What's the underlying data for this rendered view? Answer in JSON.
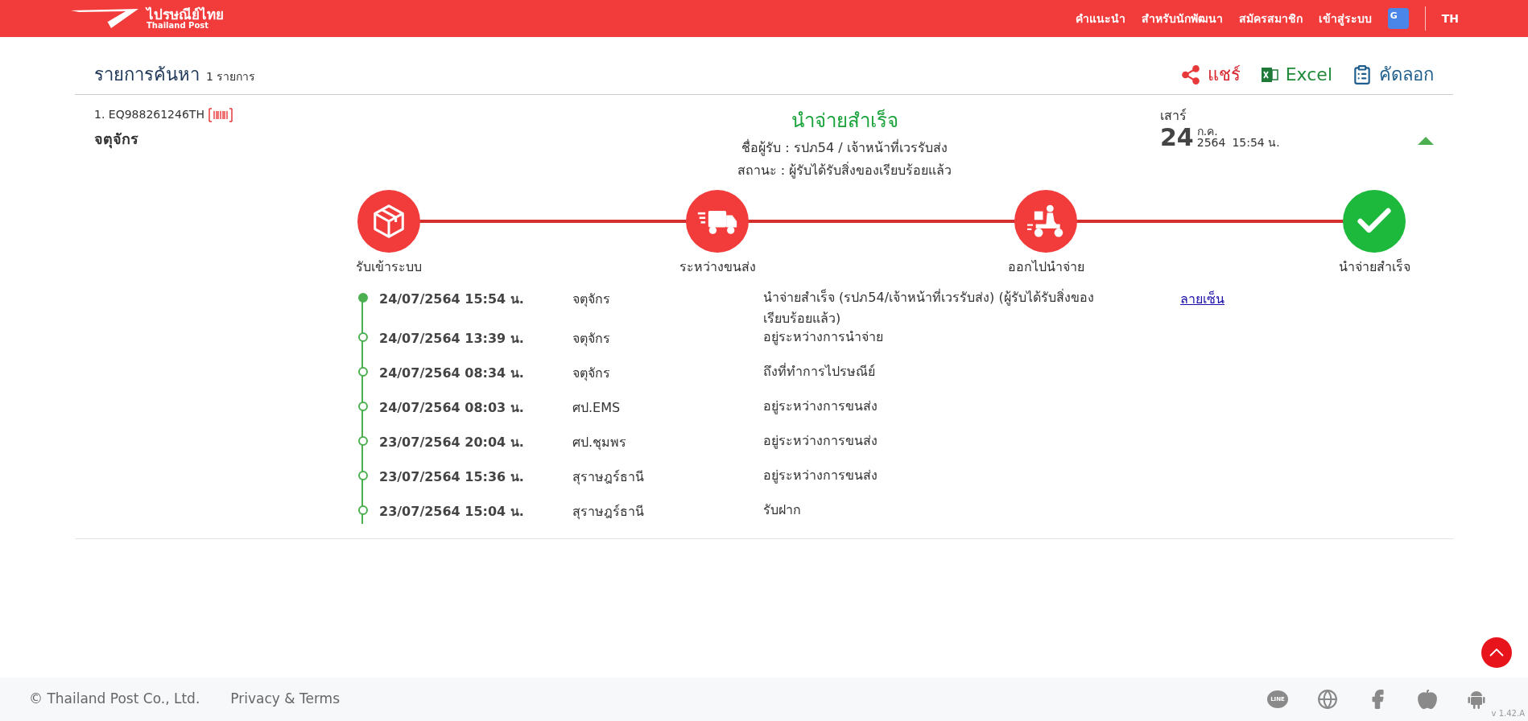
{
  "header": {
    "logo_title": "ไปรษณีย์ไทย",
    "logo_subtitle": "Thailand Post",
    "nav": [
      "คำแนะนำ",
      "สำหรับนักพัฒนา",
      "สมัครสมาชิก",
      "เข้าสู่ระบบ"
    ],
    "translate_text": "G",
    "language": "TH"
  },
  "results": {
    "title": "รายการค้นหา",
    "count": "1 รายการ",
    "actions": [
      {
        "kind": "share",
        "label": "แชร์"
      },
      {
        "kind": "excel",
        "label": "Excel"
      },
      {
        "kind": "copy",
        "label": "คัดลอก"
      }
    ]
  },
  "item": {
    "tracking": "1. EQ988261246TH",
    "destination": "จตุจักร",
    "status": "นำจ่ายสำเร็จ",
    "receiver": "ชื่อผู้รับ : รปภ54 / เจ้าหน้าที่เวรรับส่ง",
    "state": "สถานะ : ผู้รับได้รับสิ่งของเรียบร้อยแล้ว",
    "weekday": "เสาร์",
    "day": "24",
    "month": "ก.ค.",
    "year": "2564",
    "time": "15:54 น.",
    "expanded": true
  },
  "steps": [
    {
      "kind": "box",
      "label": "รับเข้าระบบ",
      "current": false
    },
    {
      "kind": "truck",
      "label": "ระหว่างขนส่ง",
      "current": false
    },
    {
      "kind": "scooter",
      "label": "ออกไปนำจ่าย",
      "current": false
    },
    {
      "kind": "check",
      "label": "นำจ่ายสำเร็จ",
      "current": true
    }
  ],
  "events": [
    {
      "date": "24/07/2564 15:54 น.",
      "location": "จตุจักร",
      "description": "นำจ่ายสำเร็จ (รปภ54/เจ้าหน้าที่เวรรับส่ง) (ผู้รับได้รับสิ่งของเรียบร้อยแล้ว)",
      "link": "ลายเซ็น",
      "current": true
    },
    {
      "date": "24/07/2564 13:39 น.",
      "location": "จตุจักร",
      "description": "อยู่ระหว่างการนำจ่าย",
      "current": false
    },
    {
      "date": "24/07/2564 08:34 น.",
      "location": "จตุจักร",
      "description": "ถึงที่ทำการไปรษณีย์",
      "current": false
    },
    {
      "date": "24/07/2564 08:03 น.",
      "location": "ศป.EMS",
      "description": "อยู่ระหว่างการขนส่ง",
      "current": false
    },
    {
      "date": "23/07/2564 20:04 น.",
      "location": "ศป.ชุมพร",
      "description": "อยู่ระหว่างการขนส่ง",
      "current": false
    },
    {
      "date": "23/07/2564 15:36 น.",
      "location": "สุราษฎร์ธานี",
      "description": "อยู่ระหว่างการขนส่ง",
      "current": false
    },
    {
      "date": "23/07/2564 15:04 น.",
      "location": "สุราษฎร์ธานี",
      "description": "รับฝาก",
      "current": false
    }
  ],
  "footer": {
    "copyright": "© Thailand Post Co., Ltd.",
    "privacy": "Privacy & Terms",
    "social": [
      {
        "kind": "line",
        "text": "LINE"
      },
      {
        "kind": "globe"
      },
      {
        "kind": "facebook"
      },
      {
        "kind": "apple"
      },
      {
        "kind": "android"
      }
    ],
    "version": "v 1.42.A"
  }
}
